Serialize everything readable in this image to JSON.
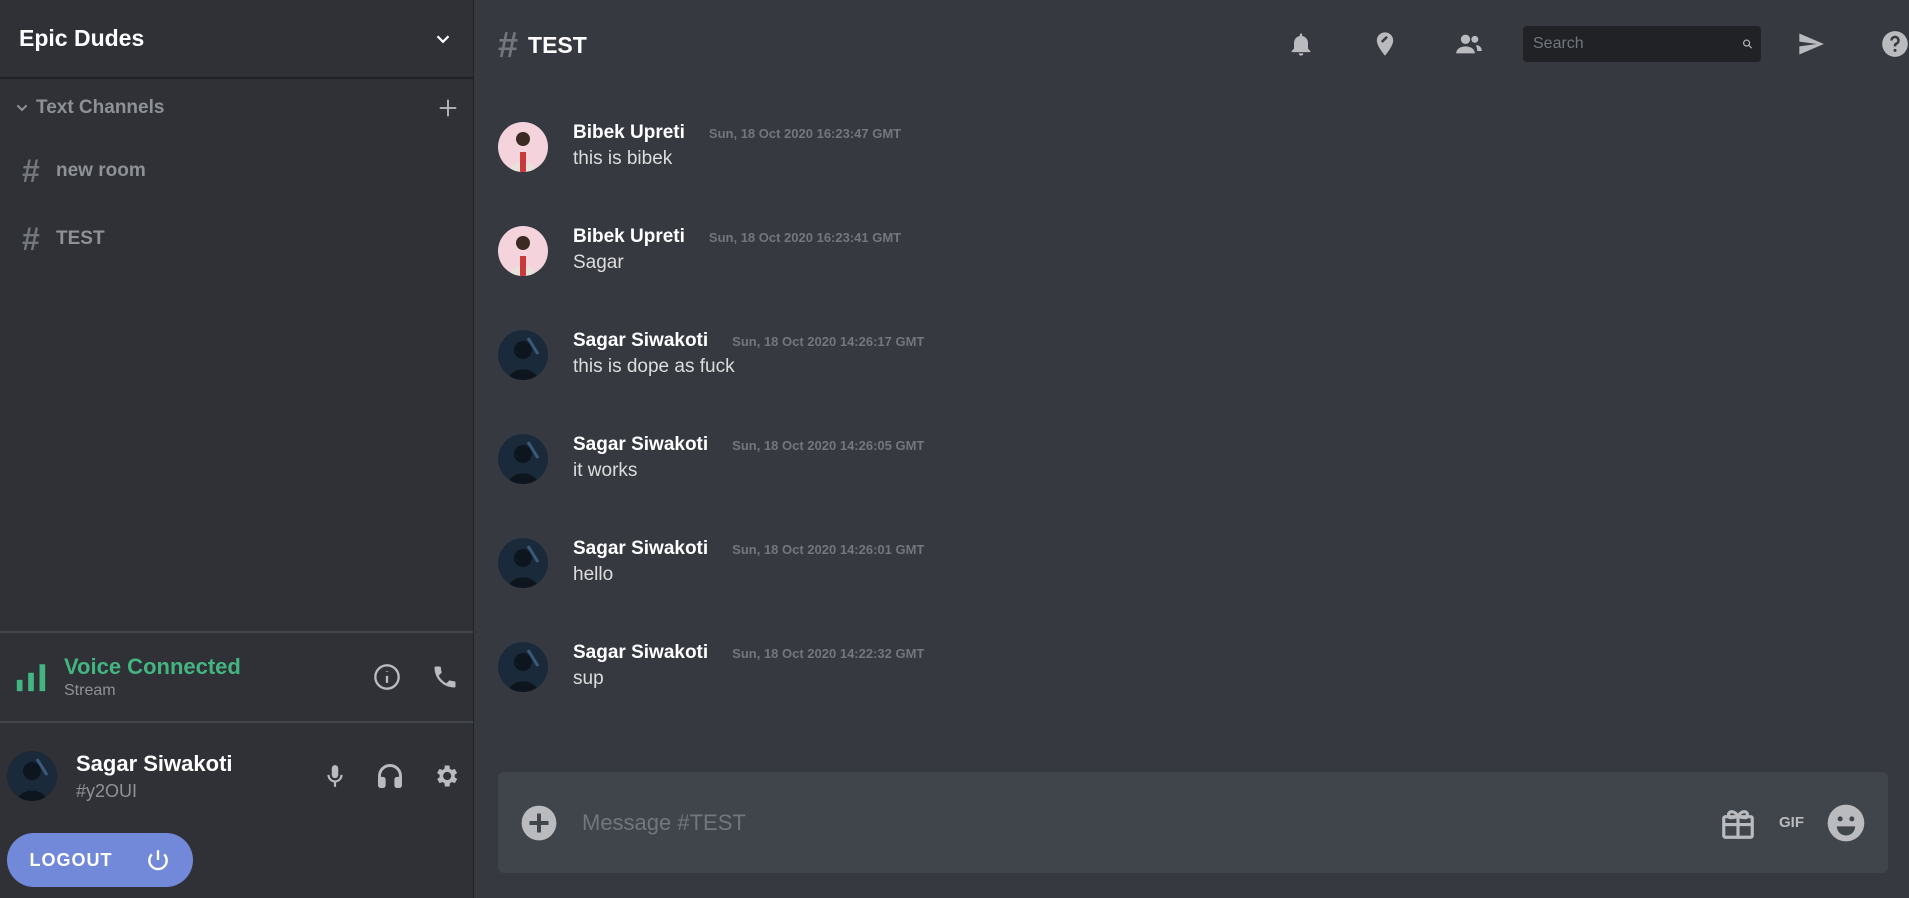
{
  "server": {
    "name": "Epic Dudes"
  },
  "sidebar": {
    "category": "Text Channels",
    "channels": [
      {
        "hash": "#",
        "name": "new room"
      },
      {
        "hash": "#",
        "name": "TEST"
      }
    ]
  },
  "voice": {
    "title": "Voice Connected",
    "subtitle": "Stream",
    "color": "#43b581"
  },
  "user": {
    "name": "Sagar Siwakoti",
    "tag": "#y2OUI"
  },
  "logout": {
    "label": "LOGOUT"
  },
  "channel_header": {
    "hash": "#",
    "title": "TEST"
  },
  "search": {
    "placeholder": "Search"
  },
  "messages": [
    {
      "author": "Bibek Upreti",
      "timestamp": "Sun, 18 Oct 2020 16:23:47 GMT",
      "text": "this is bibek"
    },
    {
      "author": "Bibek Upreti",
      "timestamp": "Sun, 18 Oct 2020 16:23:41 GMT",
      "text": "Sagar"
    },
    {
      "author": "Sagar Siwakoti",
      "timestamp": "Sun, 18 Oct 2020 14:26:17 GMT",
      "text": "this is dope as fuck"
    },
    {
      "author": "Sagar Siwakoti",
      "timestamp": "Sun, 18 Oct 2020 14:26:05 GMT",
      "text": "it works"
    },
    {
      "author": "Sagar Siwakoti",
      "timestamp": "Sun, 18 Oct 2020 14:26:01 GMT",
      "text": "hello"
    },
    {
      "author": "Sagar Siwakoti",
      "timestamp": "Sun, 18 Oct 2020 14:22:32 GMT",
      "text": "sup"
    }
  ],
  "composer": {
    "placeholder": "Message #TEST",
    "gif_label": "GIF"
  },
  "colors": {
    "accent": "#7289da",
    "background": "#36393f",
    "sidebar": "#2f3136"
  }
}
